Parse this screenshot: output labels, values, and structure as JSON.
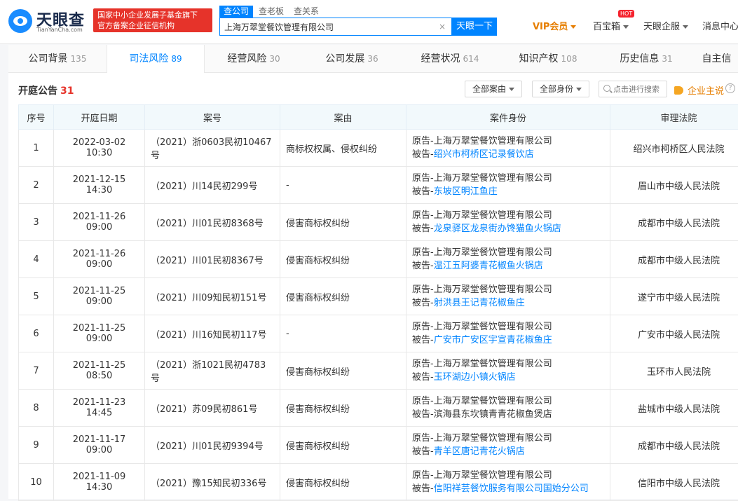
{
  "header": {
    "logo_title": "天眼查",
    "logo_sub": "TianYanCha.com",
    "badge_line1": "国家中小企业发展子基金旗下",
    "badge_line2": "官方备案企业征信机构",
    "search_tabs": [
      "查公司",
      "查老板",
      "查关系"
    ],
    "search_value": "上海万翠堂餐饮管理有限公司",
    "search_button": "天眼一下",
    "vip_label": "VIP会员",
    "treasure_label": "百宝箱",
    "hot_label": "HOT",
    "enterprise_label": "天眼企服",
    "message_label": "消息中心"
  },
  "tabs": [
    {
      "label": "公司背景",
      "count": "135"
    },
    {
      "label": "司法风险",
      "count": "89"
    },
    {
      "label": "经营风险",
      "count": "30"
    },
    {
      "label": "公司发展",
      "count": "36"
    },
    {
      "label": "经营状况",
      "count": "614"
    },
    {
      "label": "知识产权",
      "count": "108"
    },
    {
      "label": "历史信息",
      "count": "31"
    },
    {
      "label": "自主信",
      "count": ""
    }
  ],
  "section": {
    "title": "开庭公告",
    "count": "31",
    "filter_cause": "全部案由",
    "filter_identity": "全部身份",
    "search_placeholder": "点击进行搜索",
    "owner_link": "企业主说"
  },
  "table": {
    "headers": [
      "序号",
      "开庭日期",
      "案号",
      "案由",
      "案件身份",
      "审理法院"
    ],
    "rows": [
      {
        "no": "1",
        "date": "2022-03-02 10:30",
        "case_no": "（2021）浙0603民初10467号",
        "cause": "商标权权属、侵权纠纷",
        "plaintiff": "上海万翠堂餐饮管理有限公司",
        "defendant": "绍兴市柯桥区记录餐饮店",
        "defendant_linked": true,
        "court": "绍兴市柯桥区人民法院"
      },
      {
        "no": "2",
        "date": "2021-12-15 14:30",
        "case_no": "（2021）川14民初299号",
        "cause": "-",
        "plaintiff": "上海万翠堂餐饮管理有限公司",
        "defendant": "东坡区明江鱼庄",
        "defendant_linked": true,
        "court": "眉山市中级人民法院"
      },
      {
        "no": "3",
        "date": "2021-11-26 09:00",
        "case_no": "（2021）川01民初8368号",
        "cause": "侵害商标权纠纷",
        "plaintiff": "上海万翠堂餐饮管理有限公司",
        "defendant": "龙泉驿区龙泉街办馋猫鱼火锅店",
        "defendant_linked": true,
        "court": "成都市中级人民法院"
      },
      {
        "no": "4",
        "date": "2021-11-26 09:00",
        "case_no": "（2021）川01民初8367号",
        "cause": "侵害商标权纠纷",
        "plaintiff": "上海万翠堂餐饮管理有限公司",
        "defendant": "温江五阿婆青花椒鱼火锅店",
        "defendant_linked": true,
        "court": "成都市中级人民法院"
      },
      {
        "no": "5",
        "date": "2021-11-25 09:00",
        "case_no": "（2021）川09知民初151号",
        "cause": "侵害商标权纠纷",
        "plaintiff": "上海万翠堂餐饮管理有限公司",
        "defendant": "射洪县王记青花椒鱼庄",
        "defendant_linked": true,
        "court": "遂宁市中级人民法院"
      },
      {
        "no": "6",
        "date": "2021-11-25 09:00",
        "case_no": "（2021）川16知民初117号",
        "cause": "-",
        "plaintiff": "上海万翠堂餐饮管理有限公司",
        "defendant": "广安市广安区宇宣青花椒鱼庄",
        "defendant_linked": true,
        "court": "广安市中级人民法院"
      },
      {
        "no": "7",
        "date": "2021-11-25 08:50",
        "case_no": "（2021）浙1021民初4783号",
        "cause": "侵害商标权纠纷",
        "plaintiff": "上海万翠堂餐饮管理有限公司",
        "defendant": "玉环湖边小镇火锅店",
        "defendant_linked": true,
        "court": "玉环市人民法院"
      },
      {
        "no": "8",
        "date": "2021-11-23 14:45",
        "case_no": "（2021）苏09民初861号",
        "cause": "侵害商标权纠纷",
        "plaintiff": "上海万翠堂餐饮管理有限公司",
        "defendant": "滨海县东坎镇青青花椒鱼煲店",
        "defendant_linked": false,
        "court": "盐城市中级人民法院"
      },
      {
        "no": "9",
        "date": "2021-11-17 09:00",
        "case_no": "（2021）川01民初9394号",
        "cause": "侵害商标权纠纷",
        "plaintiff": "上海万翠堂餐饮管理有限公司",
        "defendant": "青羊区唐记青花火锅店",
        "defendant_linked": true,
        "court": "成都市中级人民法院"
      },
      {
        "no": "10",
        "date": "2021-11-09 14:30",
        "case_no": "（2021）豫15知民初336号",
        "cause": "侵害商标权纠纷",
        "plaintiff": "上海万翠堂餐饮管理有限公司",
        "defendant": "信阳祥芸餐饮服务有限公司国始分公司",
        "defendant_linked": true,
        "court": "信阳市中级人民法院"
      }
    ]
  },
  "labels": {
    "plaintiff_prefix": "原告-",
    "defendant_prefix": "被告-"
  },
  "colors": {
    "brand_blue": "#0084ff",
    "accent_red": "#e6332a",
    "vip_orange": "#e67e00"
  }
}
